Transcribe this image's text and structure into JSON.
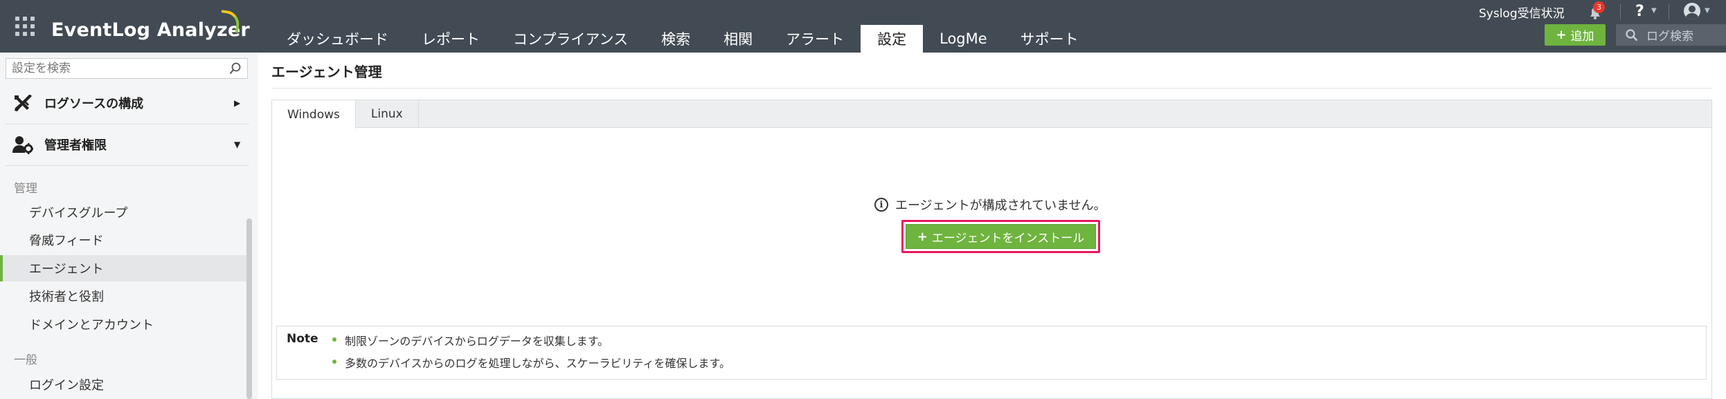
{
  "header": {
    "brand": "EventLog Analyzer",
    "nav_tabs": [
      {
        "label": "ダッシュボード"
      },
      {
        "label": "レポート"
      },
      {
        "label": "コンプライアンス"
      },
      {
        "label": "検索"
      },
      {
        "label": "相関"
      },
      {
        "label": "アラート"
      },
      {
        "label": "設定"
      },
      {
        "label": "LogMe"
      },
      {
        "label": "サポート"
      }
    ],
    "active_tab": "設定",
    "syslog_status": "Syslog受信状況",
    "notification_count": "3",
    "help_label": "?",
    "add_button": "追加",
    "log_search_label": "ログ検索"
  },
  "sidebar": {
    "search_placeholder": "設定を検索",
    "sections": [
      {
        "label": "ログソースの構成",
        "icon": "tools-icon",
        "state": "collapsed"
      },
      {
        "label": "管理者権限",
        "icon": "admin-gear-icon",
        "state": "expanded"
      }
    ],
    "group_manage": "管理",
    "items": [
      {
        "label": "デバイスグループ"
      },
      {
        "label": "脅威フィード"
      },
      {
        "label": "エージェント"
      },
      {
        "label": "技術者と役割"
      },
      {
        "label": "ドメインとアカウント"
      }
    ],
    "active_item": "エージェント",
    "group_general": "一般",
    "general_items": [
      {
        "label": "ログイン設定"
      }
    ]
  },
  "main": {
    "page_title": "エージェント管理",
    "tabs": [
      {
        "label": "Windows"
      },
      {
        "label": "Linux"
      }
    ],
    "active_tab": "Windows",
    "empty_message": "エージェントが構成されていません。",
    "install_button": "エージェントをインストール",
    "note": {
      "title": "Note",
      "items": [
        "制限ゾーンのデバイスからログデータを収集します。",
        "多数のデバイスからのログを処理しながら、スケーラビリティを確保します。"
      ]
    }
  },
  "colors": {
    "topbar": "#424b54",
    "accent_green": "#6fb43f",
    "highlight_pink": "#e8175d",
    "badge_red": "#e8372b"
  }
}
